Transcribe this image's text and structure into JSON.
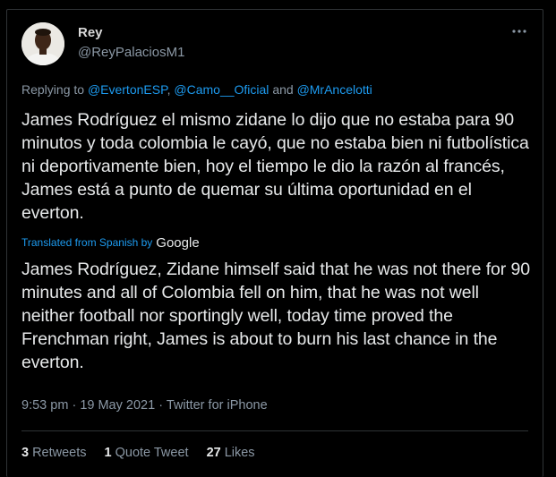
{
  "tweet": {
    "display_name": "Rey",
    "handle": "@ReyPalaciosM1",
    "replying_prefix": "Replying to",
    "mention_1": "@EvertonESP",
    "separator": ",",
    "mention_2": "@Camo__Oficial",
    "conjunction": "and",
    "mention_3": "@MrAncelotti",
    "original_text": "James Rodríguez el mismo zidane lo dijo que no estaba para 90 minutos y toda colombia le cayó, que no estaba bien ni futbolística ni deportivamente bien, hoy el tiempo le dio la razón al francés, James está a punto de quemar su última oportunidad en el everton.",
    "translated_label": "Translated from Spanish by",
    "translator": "Google",
    "translated_text": "James Rodríguez, Zidane himself said that he was not there for 90 minutes and all of Colombia fell on him, that he was not well neither football nor sportingly well, today time proved the Frenchman right, James is about to burn his last chance in the everton.",
    "time": "9:53 pm",
    "dot": "·",
    "date": "19 May 2021",
    "source": "Twitter for iPhone"
  },
  "stats": {
    "retweets_count": "3",
    "retweets_label": "Retweets",
    "quotes_count": "1",
    "quotes_label": "Quote Tweet",
    "likes_count": "27",
    "likes_label": "Likes"
  },
  "icons": {
    "avatar": "profile-photo",
    "more": "more-options-icon"
  },
  "colors": {
    "background": "#000000",
    "text": "#e7e9ea",
    "secondary": "#8b98a5",
    "link": "#1d9bf0",
    "border": "#2f3336"
  }
}
